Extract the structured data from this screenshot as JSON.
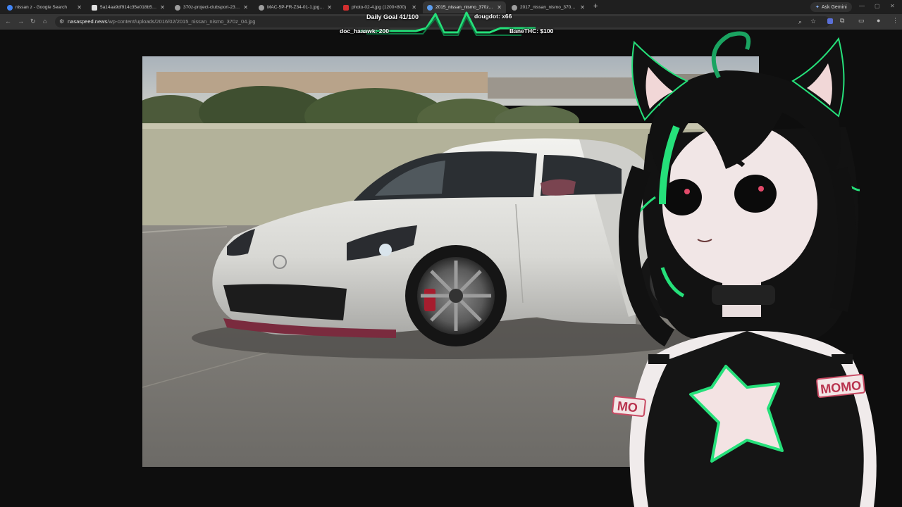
{
  "browser": {
    "tabs": [
      {
        "title": "nissan z - Google Search",
        "favicon_color": "#4285f4",
        "active": false
      },
      {
        "title": "5a14aa9df914c35e018b577e (1",
        "favicon_color": "#e0e0e0",
        "active": false
      },
      {
        "title": "370z-project-clubsport-23-2-1",
        "favicon_color": "#9e9e9e",
        "active": false
      },
      {
        "title": "MAC-5P-FR-Z34-01-1.jpg (750",
        "favicon_color": "#9e9e9e",
        "active": false
      },
      {
        "title": "photo-02-4.jpg (1200×800)",
        "favicon_color": "#d32f2f",
        "active": false
      },
      {
        "title": "2015_nissan_nismo_370z_04.jpg",
        "favicon_color": "#5c9ded",
        "active": true
      },
      {
        "title": "2017_nissan_nismo_370z_07.jp",
        "favicon_color": "#9e9e9e",
        "active": false
      }
    ],
    "new_tab_label": "+",
    "gemini_label": "Ask Gemini",
    "url_domain": "nasaspeed.news",
    "url_path": "/wp-content/uploads/2016/02/2015_nissan_nismo_370z_04.jpg"
  },
  "overlay": {
    "goal_label": "Daily Goal 41/100",
    "left_top": "",
    "right_top": "dougdot: x66",
    "left_bottom": "doc_haaawk: 200",
    "right_bottom": "BaneTHC: $100",
    "accent_color": "#25e07a"
  },
  "armband_text": "MOMO",
  "colors": {
    "tab_bg": "#1f1f1f",
    "toolbar_bg": "#353535",
    "page_bg": "#0e0e0e",
    "car_body": "#dcdcd8",
    "accent_green": "#25e07a"
  }
}
